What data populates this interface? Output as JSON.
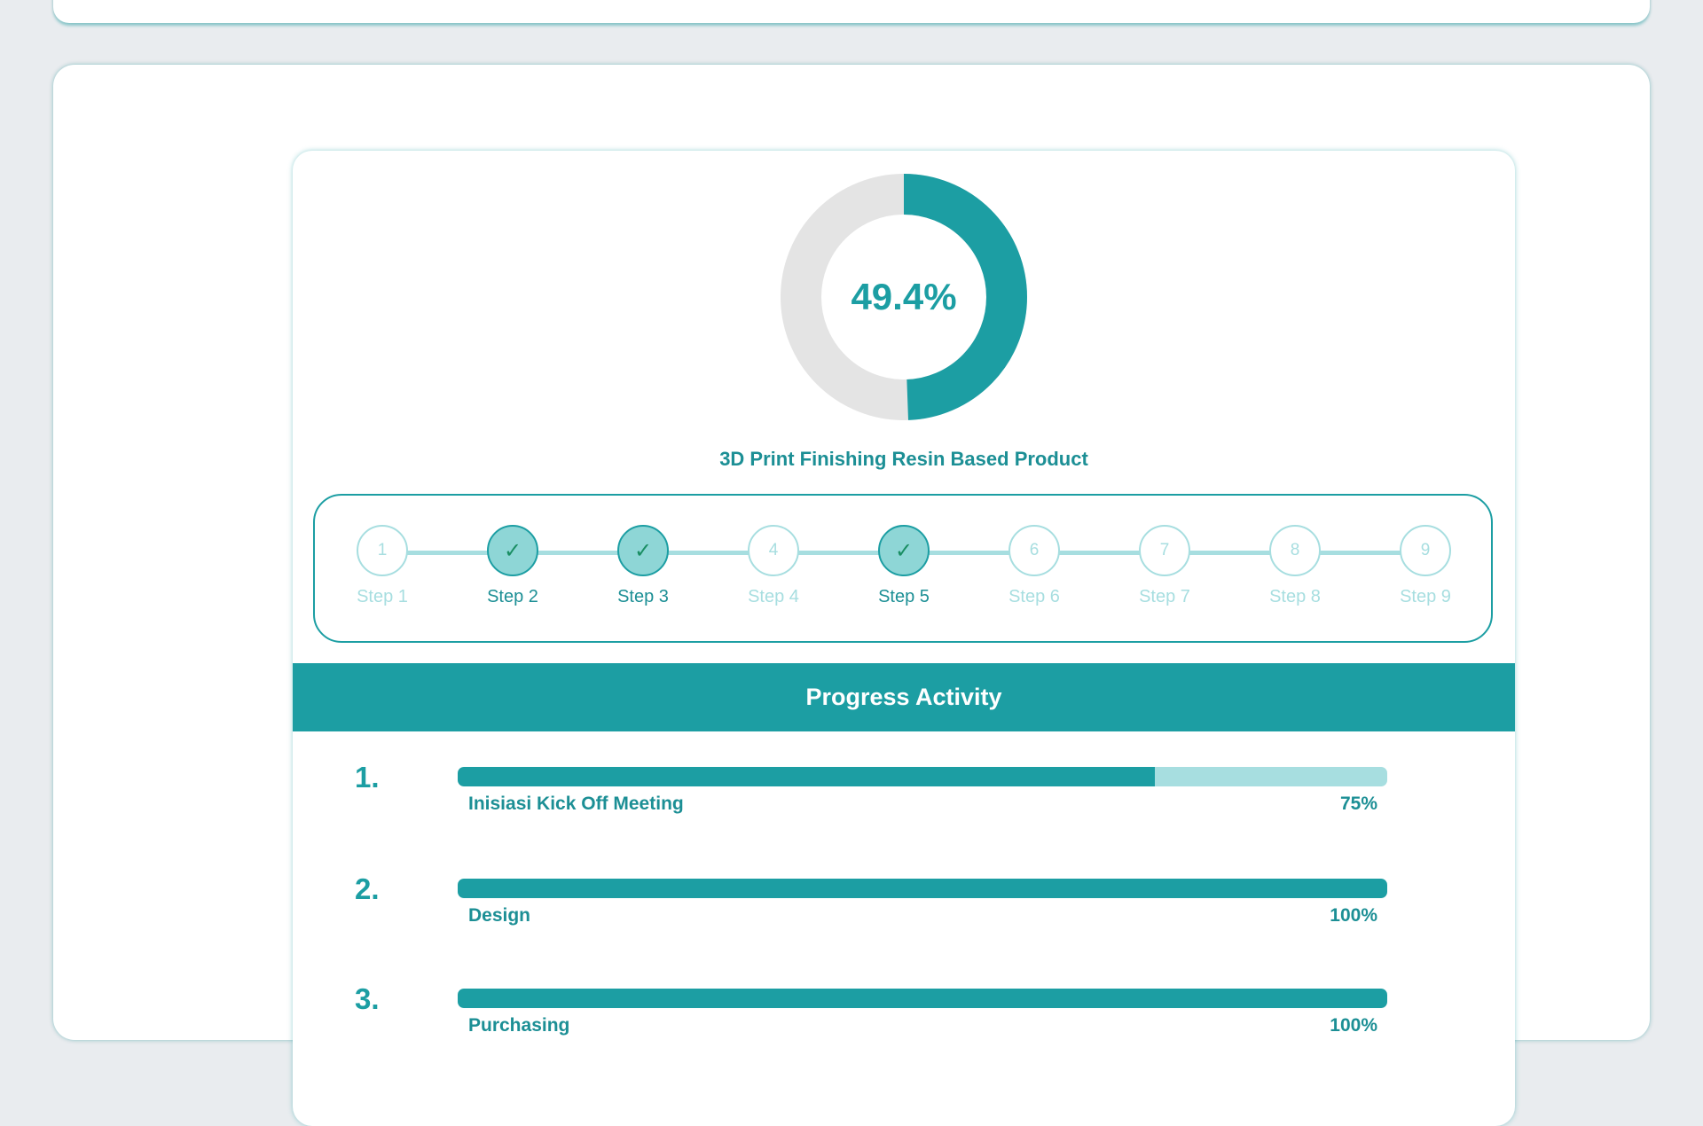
{
  "project": {
    "progress_percent": 49.4,
    "progress_label": "49.4%",
    "title": "3D Print Finishing Resin Based Product"
  },
  "colors": {
    "accent": "#1c9ea3",
    "accent_light": "#a7dee0",
    "donut_remaining": "#e4e4e4",
    "check": "#1a8e63"
  },
  "steps": [
    {
      "number": "1",
      "label": "Step 1",
      "done": false,
      "check_icon": "check-icon"
    },
    {
      "number": "2",
      "label": "Step 2",
      "done": true,
      "check_icon": "check-icon"
    },
    {
      "number": "3",
      "label": "Step 3",
      "done": true,
      "check_icon": "check-icon"
    },
    {
      "number": "4",
      "label": "Step 4",
      "done": false,
      "check_icon": "check-icon"
    },
    {
      "number": "5",
      "label": "Step 5",
      "done": true,
      "check_icon": "check-icon"
    },
    {
      "number": "6",
      "label": "Step 6",
      "done": false,
      "check_icon": "check-icon"
    },
    {
      "number": "7",
      "label": "Step 7",
      "done": false,
      "check_icon": "check-icon"
    },
    {
      "number": "8",
      "label": "Step 8",
      "done": false,
      "check_icon": "check-icon"
    },
    {
      "number": "9",
      "label": "Step 9",
      "done": false,
      "check_icon": "check-icon"
    }
  ],
  "activity": {
    "header": "Progress Activity",
    "items": [
      {
        "number": "1.",
        "name": "Inisiasi Kick Off Meeting",
        "percent": 75,
        "percent_label": "75%"
      },
      {
        "number": "2.",
        "name": "Design",
        "percent": 100,
        "percent_label": "100%"
      },
      {
        "number": "3.",
        "name": "Purchasing",
        "percent": 100,
        "percent_label": "100%"
      }
    ]
  }
}
